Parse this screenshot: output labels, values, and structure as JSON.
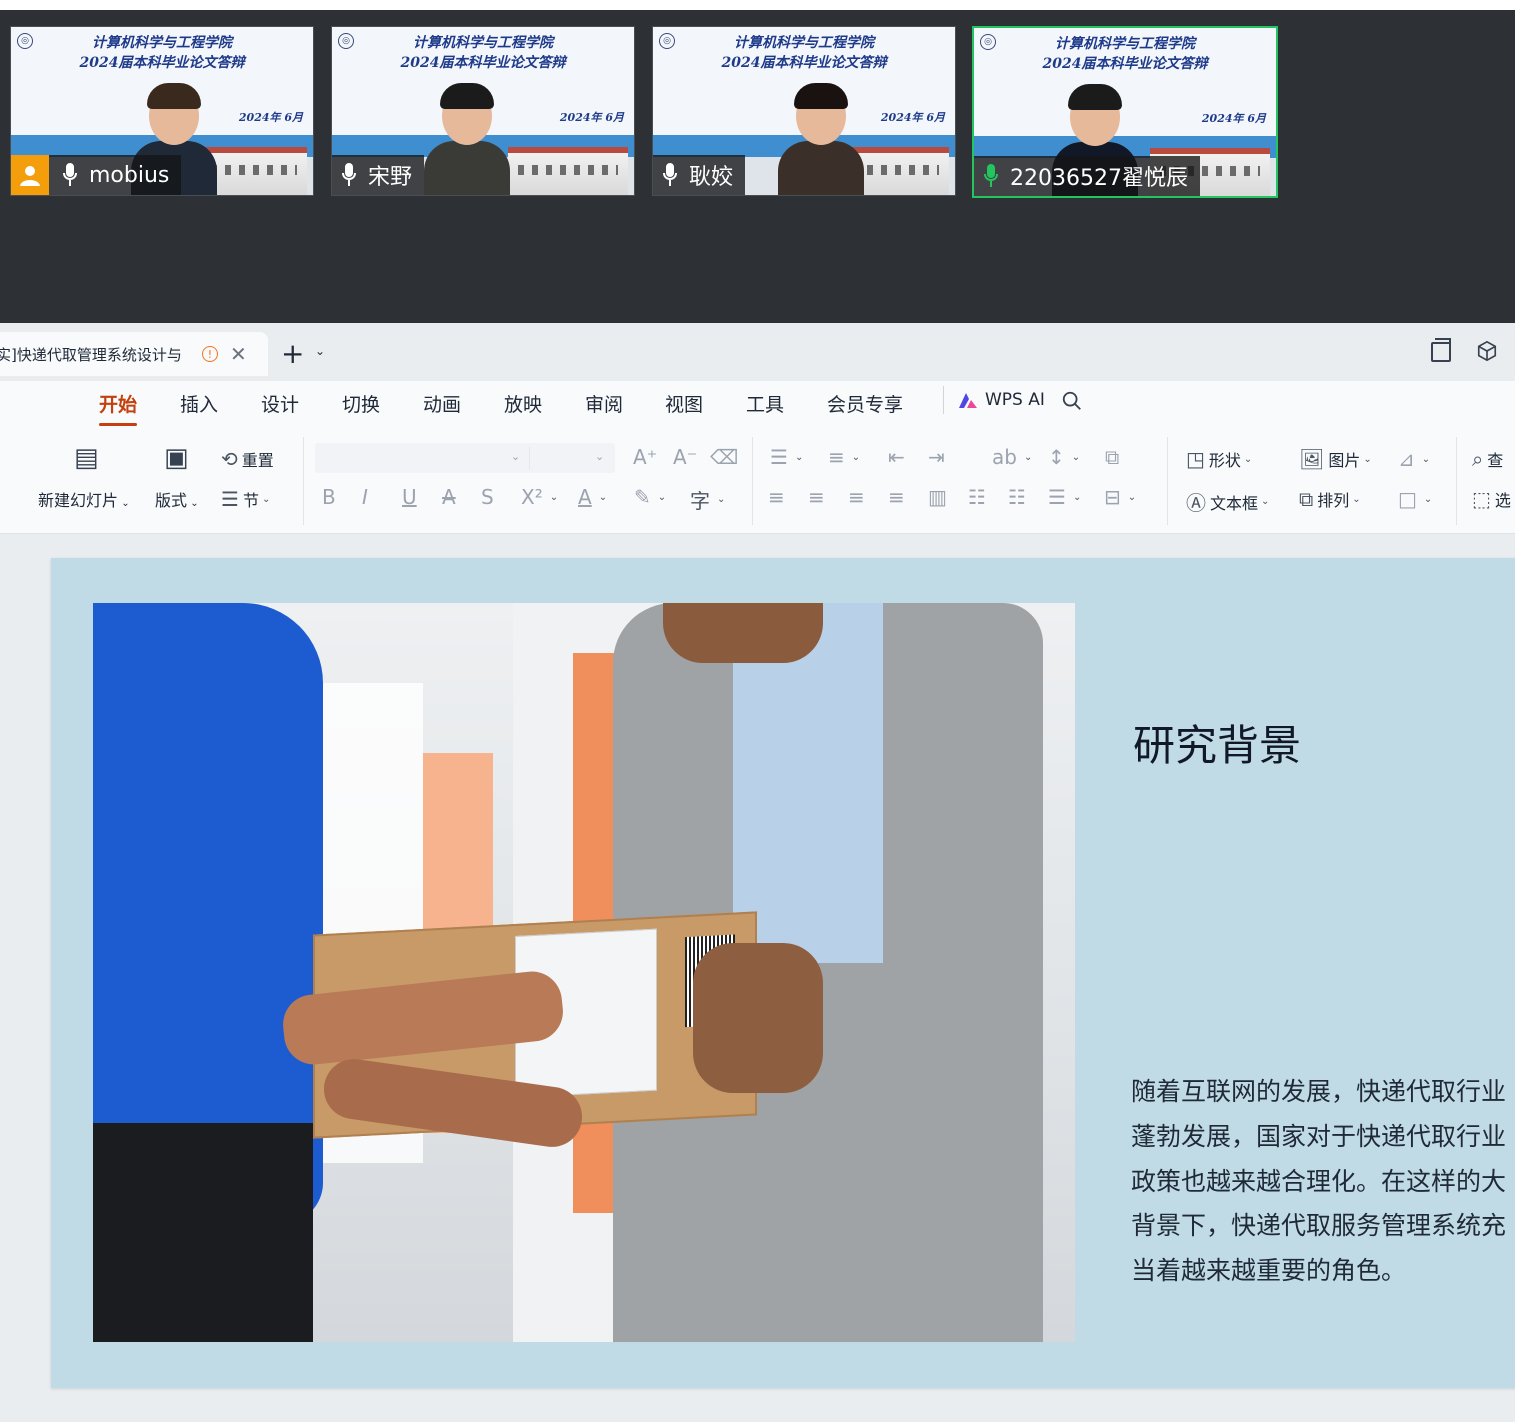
{
  "meeting": {
    "participants": [
      {
        "name": "mobius",
        "banner_line1": "计算机科学与工程学院",
        "banner_line2": "2024届本科毕业论文答辩",
        "date": "2024年 6月",
        "has_avatar_badge": true,
        "active": false,
        "mic_color": "#ffffff"
      },
      {
        "name": "宋野",
        "banner_line1": "计算机科学与工程学院",
        "banner_line2": "2024届本科毕业论文答辩",
        "date": "2024年 6月",
        "has_avatar_badge": false,
        "active": false,
        "mic_color": "#ffffff"
      },
      {
        "name": "耿姣",
        "banner_line1": "计算机科学与工程学院",
        "banner_line2": "2024届本科毕业论文答辩",
        "date": "2024年 6月",
        "has_avatar_badge": false,
        "active": false,
        "mic_color": "#ffffff"
      },
      {
        "name": "22036527翟悦辰",
        "banner_line1": "计算机科学与工程学院",
        "banner_line2": "2024届本科毕业论文答辩",
        "date": "2024年 6月",
        "has_avatar_badge": false,
        "active": true,
        "mic_color": "#22c55e"
      }
    ]
  },
  "tabbar": {
    "doc_title": "实]快递代取管理系统设计与",
    "warn_glyph": "!",
    "close_glyph": "✕",
    "new_tab_glyph": "+",
    "menu_glyph": "⌄"
  },
  "ribbon": {
    "tabs": [
      "开始",
      "插入",
      "设计",
      "切换",
      "动画",
      "放映",
      "审阅",
      "视图",
      "工具",
      "会员专享"
    ],
    "active_tab": "开始",
    "wps_ai": "WPS AI"
  },
  "toolbar": {
    "new_slide": "新建幻灯片",
    "layout": "版式",
    "reset": "重置",
    "section": "节",
    "shape": "形状",
    "picture": "图片",
    "textbox": "文本框",
    "arrange": "排列",
    "find": "查",
    "select": "选"
  },
  "slide": {
    "title": "研究背景",
    "body": "随着互联网的发展，快递代取行业蓬勃发展，国家对于快递代取行业政策也越来越合理化。在这样的大背景下，快递代取服务管理系统充当着越来越重要的角色。"
  },
  "colors": {
    "accent": "#c2410c",
    "active_border": "#22c55e",
    "slide_bg": "#c1dbe6",
    "avatar_badge": "#f59e0b"
  }
}
